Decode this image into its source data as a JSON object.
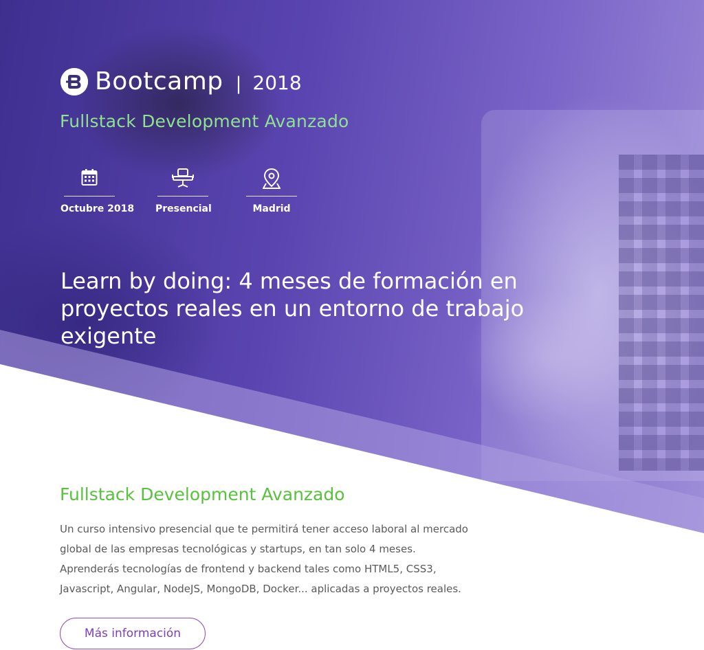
{
  "hero": {
    "brand_name": "Bootcamp",
    "separator": "|",
    "year": "2018",
    "subtitle": "Fullstack Development Avanzado",
    "meta": [
      {
        "icon": "calendar-icon",
        "label": "Octubre 2018"
      },
      {
        "icon": "chair-icon",
        "label": "Presencial"
      },
      {
        "icon": "location-pin-icon",
        "label": "Madrid"
      }
    ],
    "tagline": "Learn by doing: 4 meses de formación en proyectos reales en un entorno de trabajo exigente"
  },
  "content": {
    "title": "Fullstack Development Avanzado",
    "description": "Un curso intensivo presencial que te permitirá tener acceso laboral al mercado global de las empresas tecnológicas y startups, en tan solo 4 meses. Aprenderás tecnologías de frontend y backend tales como HTML5, CSS3, Javascript, Angular, NodeJS, MongoDB, Docker... aplicadas a proyectos reales.",
    "button_label": "Más información"
  },
  "colors": {
    "hero_purple": "#5a45b0",
    "subtitle_green": "#8fe28f",
    "title_green": "#58c23c",
    "button_purple": "#7b3fb8",
    "body_text": "#5a5a5a"
  }
}
